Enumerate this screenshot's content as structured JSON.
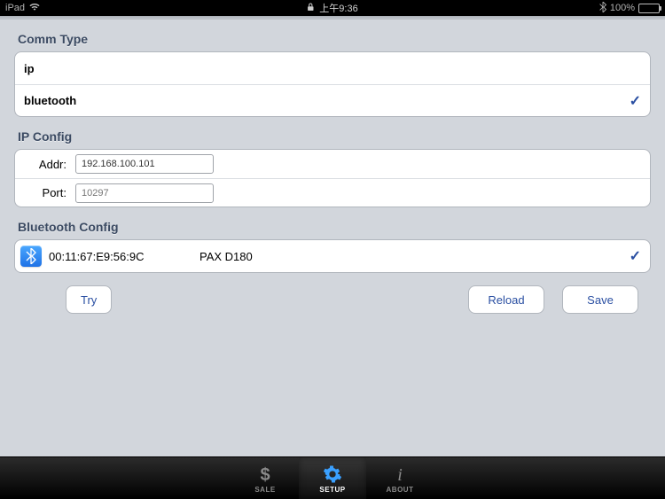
{
  "status_bar": {
    "carrier": "iPad",
    "time": "上午9:36",
    "battery_percent": "100%"
  },
  "sections": {
    "comm_type": {
      "header": "Comm Type",
      "options": [
        {
          "label": "ip",
          "selected": false
        },
        {
          "label": "bluetooth",
          "selected": true
        }
      ]
    },
    "ip_config": {
      "header": "IP Config",
      "addr_label": "Addr:",
      "addr_value": "192.168.100.101",
      "port_label": "Port:",
      "port_placeholder": "10297"
    },
    "bluetooth_config": {
      "header": "Bluetooth Config",
      "mac": "00:11:67:E9:56:9C",
      "device_name": "PAX D180",
      "selected": true
    }
  },
  "buttons": {
    "try": "Try",
    "reload": "Reload",
    "save": "Save"
  },
  "tab_bar": {
    "sale": "SALE",
    "setup": "SETUP",
    "about": "ABOUT",
    "active": "setup"
  }
}
